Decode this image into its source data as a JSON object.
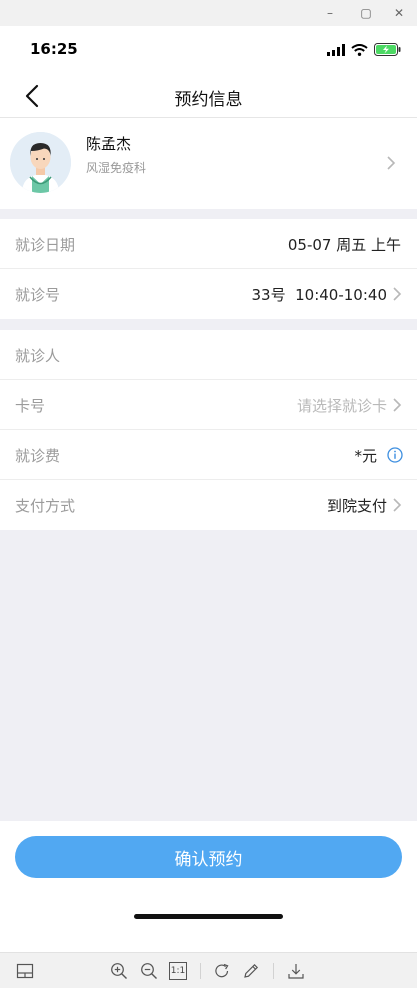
{
  "window": {
    "controls": [
      {
        "name": "minimize",
        "glyph": "–"
      },
      {
        "name": "maximize",
        "glyph": "▢"
      },
      {
        "name": "close",
        "glyph": "✕"
      }
    ]
  },
  "status_bar": {
    "time": "16:25",
    "icons": [
      "signal-icon",
      "wifi-icon",
      "battery-charging-icon"
    ],
    "battery_color": "#4cd964"
  },
  "nav": {
    "back_icon": "chevron-left-icon",
    "title": "预约信息"
  },
  "profile": {
    "name": "陈孟杰",
    "department": "风湿免疫科",
    "avatar_icon": "doctor-avatar-icon"
  },
  "visit_group": {
    "rows": [
      {
        "label": "就诊日期",
        "value": "05-07 周五 上午",
        "chevron": false
      },
      {
        "label": "就诊号",
        "value": "33号  10:40-10:40",
        "chevron": true
      }
    ]
  },
  "patient_group": {
    "rows": [
      {
        "label": "就诊人",
        "value": "",
        "chevron": false
      },
      {
        "label": "卡号",
        "placeholder": "请选择就诊卡",
        "chevron": true
      },
      {
        "label": "就诊费",
        "value": "*元",
        "info_icon": "info-icon"
      },
      {
        "label": "支付方式",
        "value": "到院支付",
        "chevron": true
      }
    ]
  },
  "actions": {
    "confirm_label": "确认预约"
  },
  "colors": {
    "accent": "#51a8f2",
    "page_bg": "#efeff4",
    "label_gray": "#9b9b9b",
    "placeholder_gray": "#b9b9b9"
  },
  "toolbar": {
    "icons": [
      "sidebar-toggle-icon",
      "zoom-in-icon",
      "zoom-out-icon",
      "actual-size-icon",
      "rotate-icon",
      "edit-icon",
      "download-icon"
    ],
    "actual_size_label": "1:1"
  }
}
